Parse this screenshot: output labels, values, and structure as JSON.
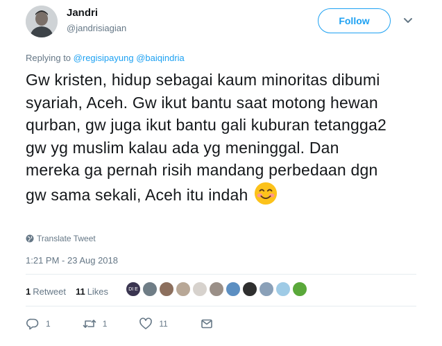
{
  "author": {
    "name": "Jandri",
    "handle": "@jandrisiagian"
  },
  "follow_label": "Follow",
  "replying_prefix": "Replying to",
  "replying_to": [
    "@regisipayung",
    "@baiqindria"
  ],
  "tweet_text": "Gw kristen, hidup sebagai kaum minoritas dibumi syariah, Aceh. Gw ikut bantu saat motong hewan qurban, gw juga ikut bantu gali kuburan tetangga2 gw yg muslim kalau ada yg meninggal. Dan mereka ga pernah risih mandang perbedaan dgn gw sama sekali, Aceh itu indah",
  "translate_label": "Translate Tweet",
  "timestamp": "1:21 PM - 23 Aug 2018",
  "stats": {
    "retweets_count": "1",
    "retweets_label": "Retweet",
    "likes_count": "11",
    "likes_label": "Likes"
  },
  "likers": [
    {
      "icon": "liker-avatar",
      "color": "#3a3550",
      "label": "DI E"
    },
    {
      "icon": "liker-avatar",
      "color": "#6f7d86"
    },
    {
      "icon": "liker-avatar",
      "color": "#8c6f5d"
    },
    {
      "icon": "liker-avatar",
      "color": "#b8a796"
    },
    {
      "icon": "liker-avatar",
      "color": "#d7d2cd"
    },
    {
      "icon": "liker-avatar",
      "color": "#9a8f87"
    },
    {
      "icon": "liker-avatar",
      "color": "#5c8fc2"
    },
    {
      "icon": "liker-avatar",
      "color": "#2f2f2f"
    },
    {
      "icon": "liker-avatar",
      "color": "#8aa0b8"
    },
    {
      "icon": "liker-avatar",
      "color": "#9fcbe6"
    },
    {
      "icon": "liker-avatar",
      "color": "#5aa83a"
    }
  ],
  "actions": {
    "reply_count": "1",
    "retweet_count": "1",
    "like_count": "11"
  },
  "colors": {
    "accent": "#1da1f2",
    "muted": "#657786",
    "text": "#14171a",
    "divider": "#e6ecf0"
  }
}
